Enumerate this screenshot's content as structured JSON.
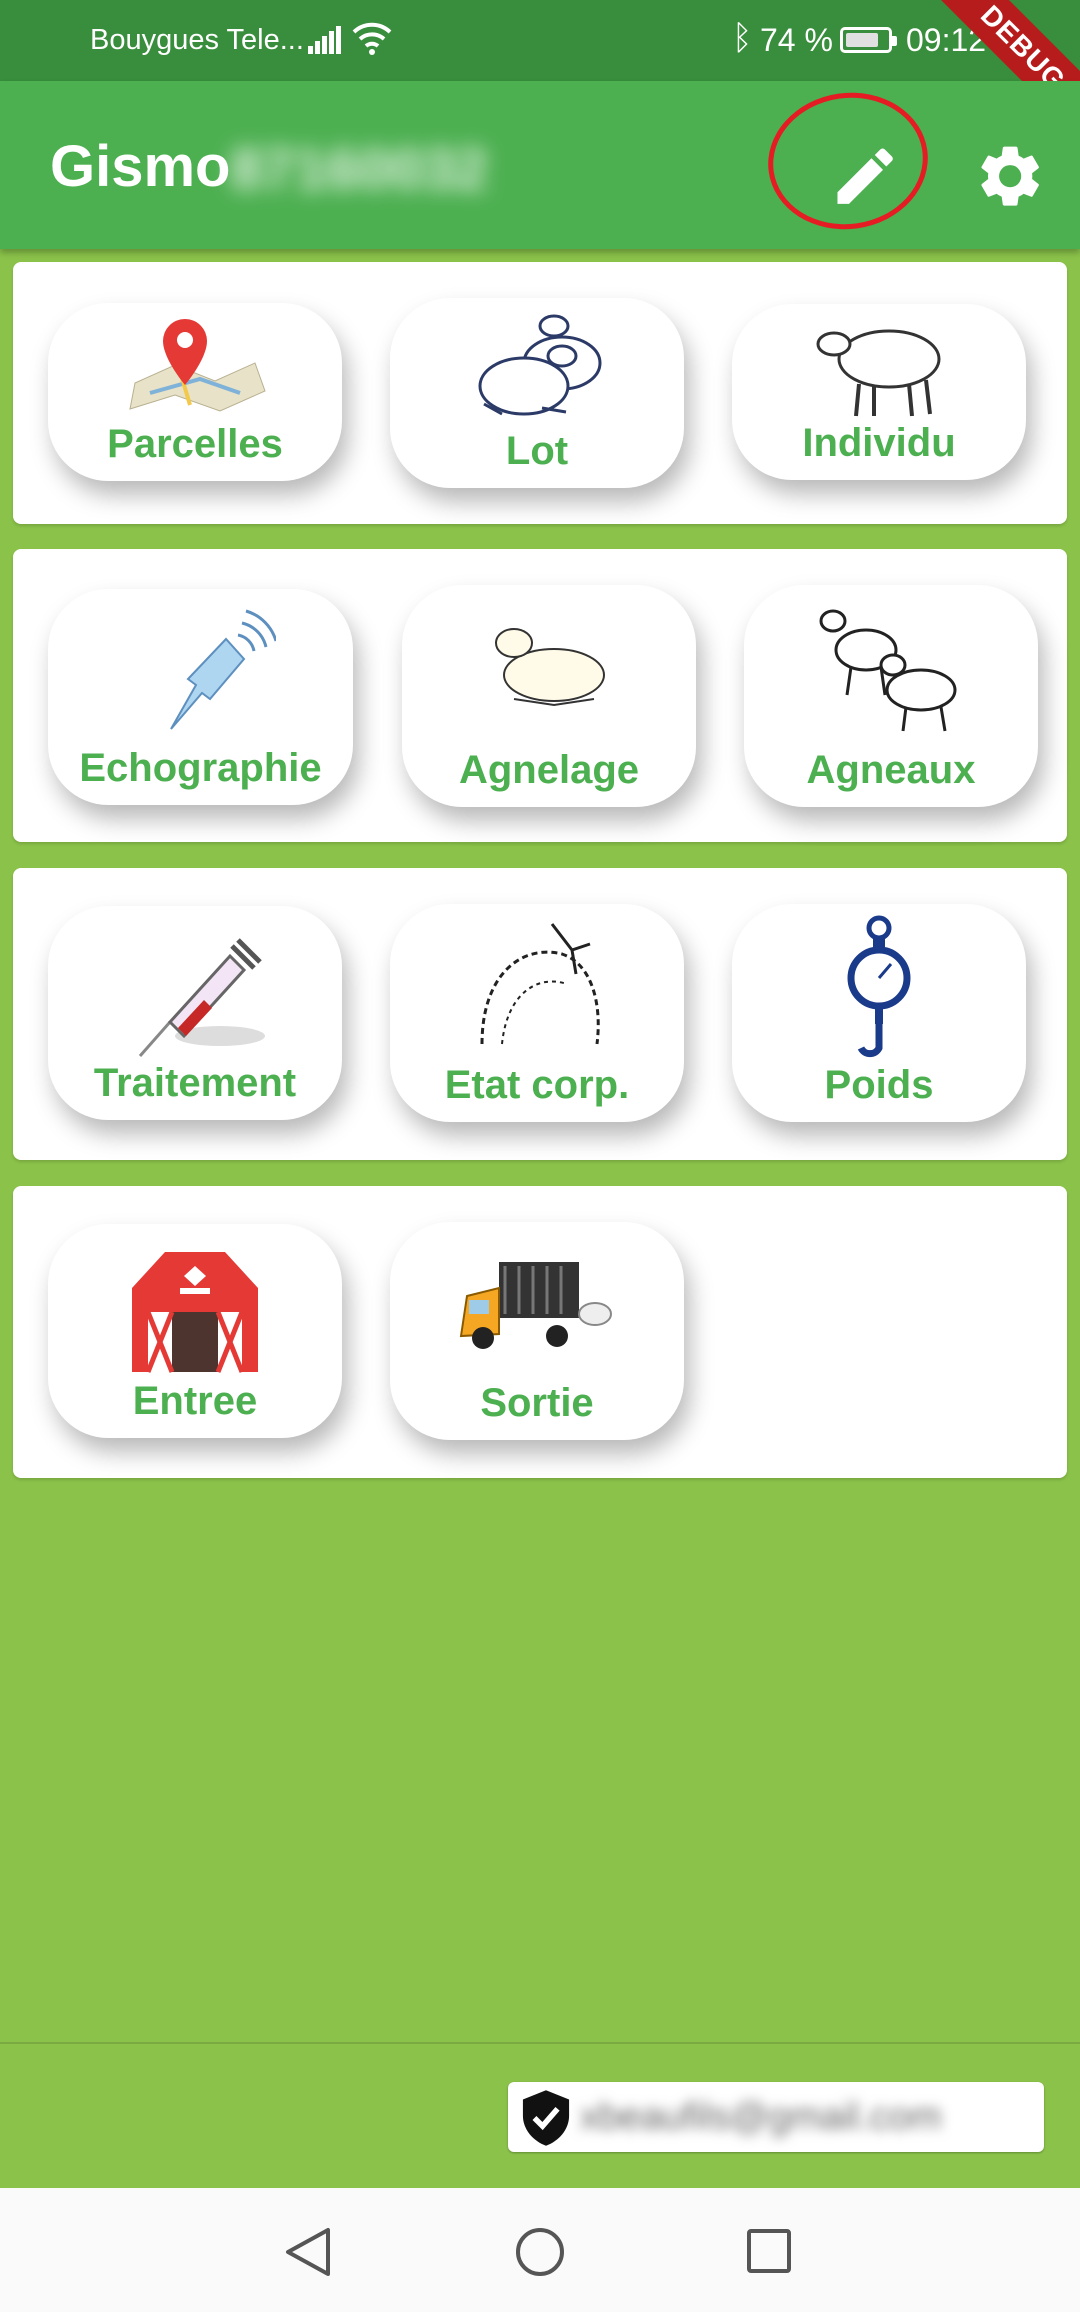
{
  "status_bar": {
    "carrier": "Bouygues Tele...",
    "battery": "74 %",
    "time": "09:12",
    "debug_banner": "DEBUG"
  },
  "app_bar": {
    "title": "Gismo",
    "subtitle_blurred": "87160032",
    "edit_icon": "pencil-icon",
    "settings_icon": "gear-icon"
  },
  "cards": [
    {
      "tiles": [
        {
          "label": "Parcelles",
          "icon": "map-pin-icon"
        },
        {
          "label": "Lot",
          "icon": "sheep-pair-icon"
        },
        {
          "label": "Individu",
          "icon": "sheep-icon"
        }
      ]
    },
    {
      "tiles": [
        {
          "label": "Echographie",
          "icon": "ultrasound-probe-icon"
        },
        {
          "label": "Agnelage",
          "icon": "lamb-lying-icon"
        },
        {
          "label": "Agneaux",
          "icon": "lambs-icon"
        }
      ]
    },
    {
      "tiles": [
        {
          "label": "Traitement",
          "icon": "syringe-icon"
        },
        {
          "label": "Etat corp.",
          "icon": "body-condition-icon"
        },
        {
          "label": "Poids",
          "icon": "hanging-scale-icon"
        }
      ]
    },
    {
      "tiles": [
        {
          "label": "Entree",
          "icon": "barn-icon"
        },
        {
          "label": "Sortie",
          "icon": "livestock-truck-icon"
        }
      ]
    }
  ],
  "account": {
    "email": "xbeaufils@gmail.com",
    "icon": "verified-shield-icon"
  },
  "colors": {
    "background": "#8bc34a",
    "app_bar": "#4caf50",
    "status_bar": "#388e3c",
    "label": "#4caf50"
  }
}
